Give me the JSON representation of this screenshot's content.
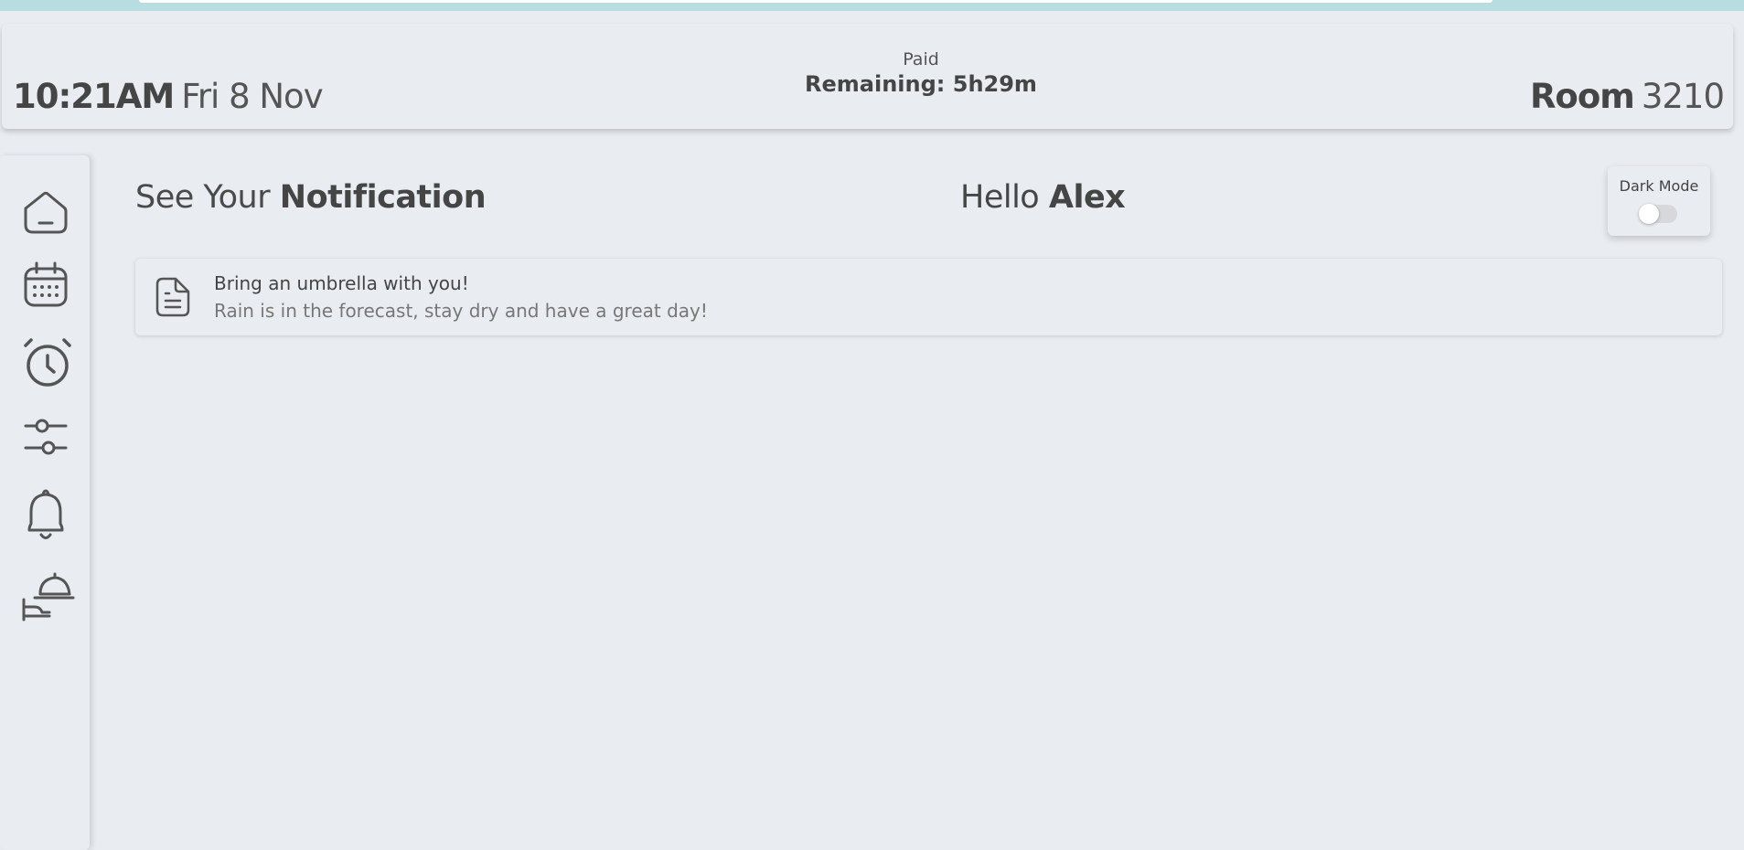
{
  "header": {
    "time": "10:21AM",
    "date": "Fri 8 Nov",
    "payment_status": "Paid",
    "remaining": "Remaining: 5h29m",
    "room_label": "Room",
    "room_number": "3210"
  },
  "sidebar": {
    "items": [
      {
        "name": "home",
        "icon": "home-icon"
      },
      {
        "name": "calendar",
        "icon": "calendar-icon"
      },
      {
        "name": "alarm",
        "icon": "alarm-clock-icon"
      },
      {
        "name": "settings",
        "icon": "sliders-icon"
      },
      {
        "name": "notifications",
        "icon": "bell-icon"
      },
      {
        "name": "room-service",
        "icon": "room-service-icon"
      }
    ]
  },
  "main": {
    "title_prefix": "See Your",
    "title_bold": "Notification",
    "greeting": "Hello",
    "user_name": "Alex",
    "dark_mode_label": "Dark Mode",
    "dark_mode_on": false
  },
  "notifications": [
    {
      "title": "Bring an umbrella with you!",
      "body": "Rain is in the forecast, stay dry and have a great day!",
      "icon": "document-icon"
    }
  ],
  "colors": {
    "background": "#e9ecf0",
    "top_strip": "#b7dde0",
    "text": "#454545"
  }
}
